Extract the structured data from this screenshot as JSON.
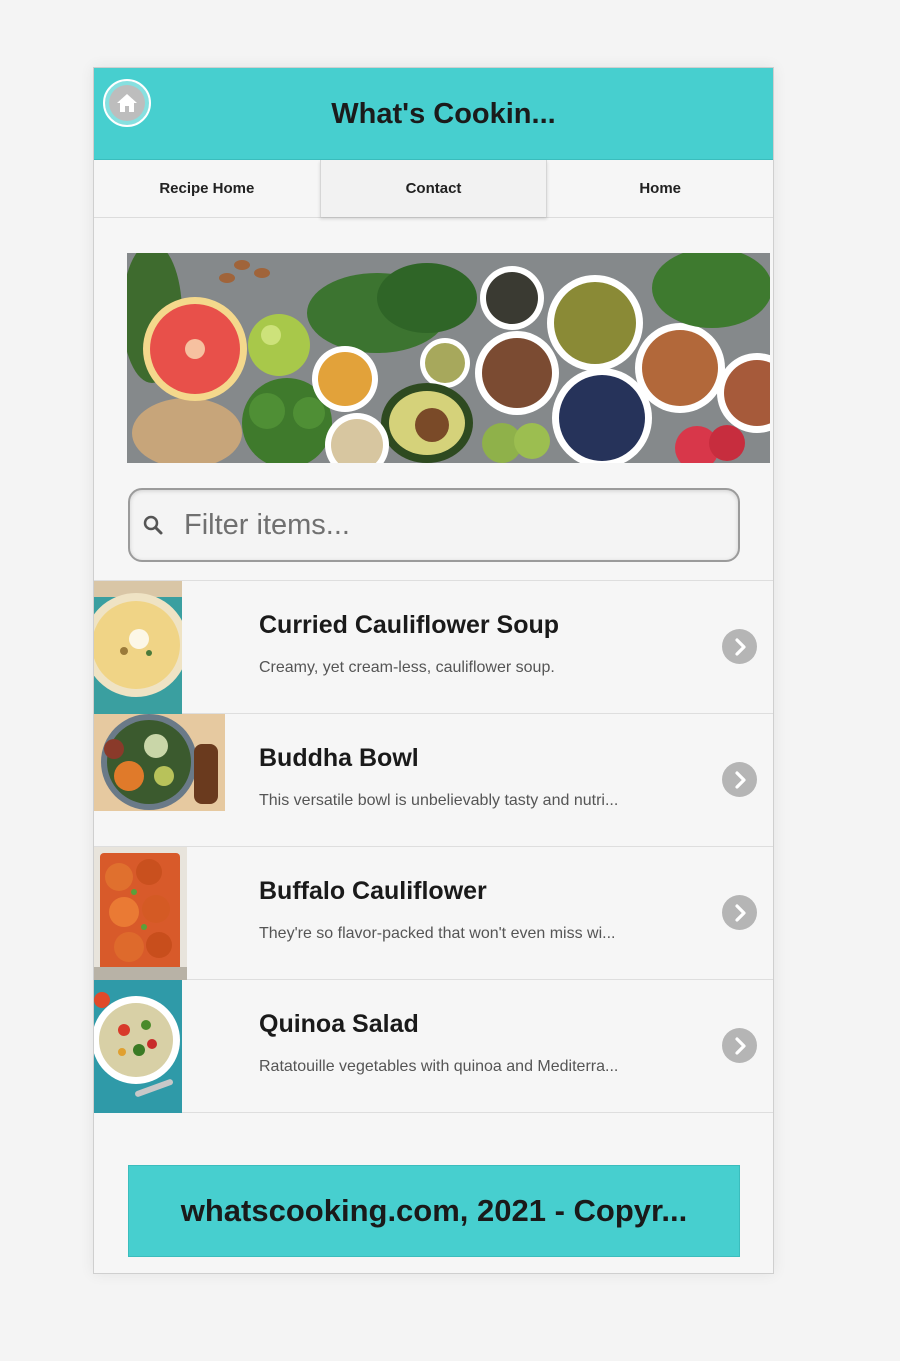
{
  "app": {
    "title": "What's Cookin...",
    "accent_color": "#47cfcf"
  },
  "header": {
    "home_icon": "home-icon"
  },
  "nav": {
    "items": [
      {
        "label": "Recipe Home",
        "active": false
      },
      {
        "label": "Contact",
        "active": true
      },
      {
        "label": "Home",
        "active": false
      }
    ]
  },
  "search": {
    "placeholder": "Filter items...",
    "value": "",
    "icon": "search-icon"
  },
  "recipes": [
    {
      "name": "Curried Cauliflower Soup",
      "description": "Creamy, yet cream-less, cauliflower soup."
    },
    {
      "name": "Buddha Bowl",
      "description": "This versatile bowl is unbelievably tasty and nutri..."
    },
    {
      "name": "Buffalo Cauliflower",
      "description": "They're so flavor-packed that won't even miss wi..."
    },
    {
      "name": "Quinoa Salad",
      "description": "Ratatouille vegetables with quinoa and Mediterra..."
    }
  ],
  "footer": {
    "text": "whatscooking.com, 2021 - Copyr..."
  }
}
